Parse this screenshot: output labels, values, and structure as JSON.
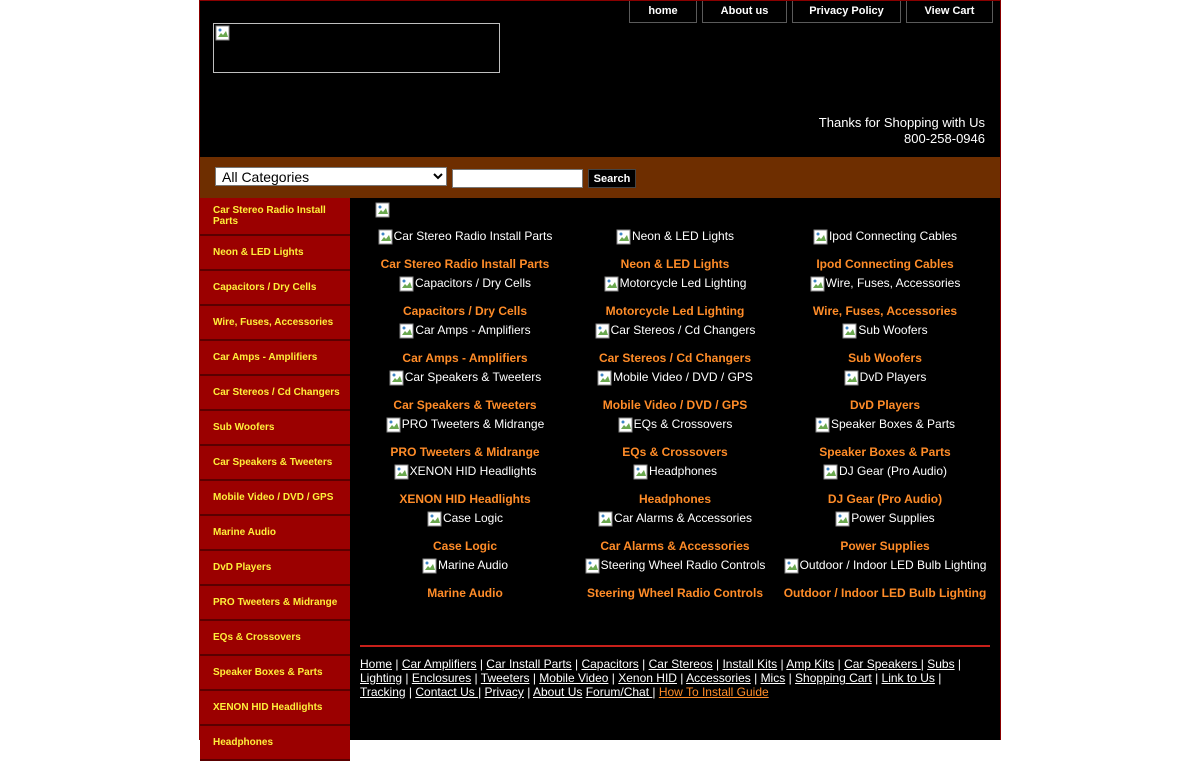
{
  "topnav": [
    {
      "label": "home"
    },
    {
      "label": "About us"
    },
    {
      "label": "Privacy Policy"
    },
    {
      "label": "View Cart"
    }
  ],
  "header": {
    "thanks": "Thanks for Shopping with Us",
    "phone": "800-258-0946"
  },
  "search": {
    "category_selected": "All Categories",
    "query": "",
    "button_label": "Search"
  },
  "sidebar": [
    "Car Stereo Radio Install Parts",
    "Neon & LED Lights",
    "Capacitors / Dry Cells",
    "Wire, Fuses, Accessories",
    "Car Amps - Amplifiers",
    "Car Stereos / Cd Changers",
    "Sub Woofers",
    "Car Speakers & Tweeters",
    "Mobile Video / DVD / GPS",
    "Marine Audio",
    "DvD Players",
    "PRO Tweeters & Midrange",
    "EQs & Crossovers",
    "Speaker Boxes & Parts",
    "XENON HID Headlights",
    "Headphones"
  ],
  "categories": [
    [
      "Car Stereo Radio Install Parts",
      "Neon & LED Lights",
      "Ipod Connecting Cables"
    ],
    [
      "Capacitors / Dry Cells",
      "Motorcycle Led Lighting",
      "Wire, Fuses, Accessories"
    ],
    [
      "Car Amps - Amplifiers",
      "Car Stereos / Cd Changers",
      "Sub Woofers"
    ],
    [
      "Car Speakers & Tweeters",
      "Mobile Video / DVD / GPS",
      "DvD Players"
    ],
    [
      "PRO Tweeters & Midrange",
      "EQs & Crossovers",
      "Speaker Boxes & Parts"
    ],
    [
      "XENON HID Headlights",
      "Headphones",
      "DJ Gear (Pro Audio)"
    ],
    [
      "Case Logic",
      "Car Alarms & Accessories",
      "Power Supplies"
    ],
    [
      "Marine Audio",
      "Steering Wheel Radio Controls",
      "Outdoor / Indoor LED Bulb Lighting"
    ]
  ],
  "footer_links": [
    {
      "label": "Home",
      "sep": " | "
    },
    {
      "label": "Car Amplifiers",
      "sep": " | "
    },
    {
      "label": "Car Install Parts",
      "sep": " | "
    },
    {
      "label": "Capacitors",
      "sep": " | "
    },
    {
      "label": "Car Stereos",
      "sep": " | "
    },
    {
      "label": "Install Kits",
      "sep": " | "
    },
    {
      "label": "Amp Kits",
      "sep": " | "
    },
    {
      "label": "Car Speakers ",
      "sep": "| "
    },
    {
      "label": "Subs",
      "sep": " | "
    },
    {
      "label": "Lighting",
      "sep": " | "
    },
    {
      "label": "Enclosures",
      "sep": " | "
    },
    {
      "label": "Tweeters",
      "sep": " | "
    },
    {
      "label": "Mobile Video",
      "sep": " | "
    },
    {
      "label": "Xenon HID",
      "sep": " | "
    },
    {
      "label": "Accessories",
      "sep": " | "
    },
    {
      "label": "Mics",
      "sep": " | "
    },
    {
      "label": "Shopping Cart",
      "sep": " | "
    },
    {
      "label": "Link to Us",
      "sep": " | "
    },
    {
      "label": "Tracking",
      "sep": " | "
    },
    {
      "label": "Contact Us ",
      "sep": "| "
    },
    {
      "label": "Privacy",
      "sep": " | "
    },
    {
      "label": "About Us",
      "sep": " "
    },
    {
      "label": "Forum/Chat ",
      "sep": "| "
    },
    {
      "label": "How To Install Guide",
      "sep": "",
      "accent": true
    }
  ]
}
